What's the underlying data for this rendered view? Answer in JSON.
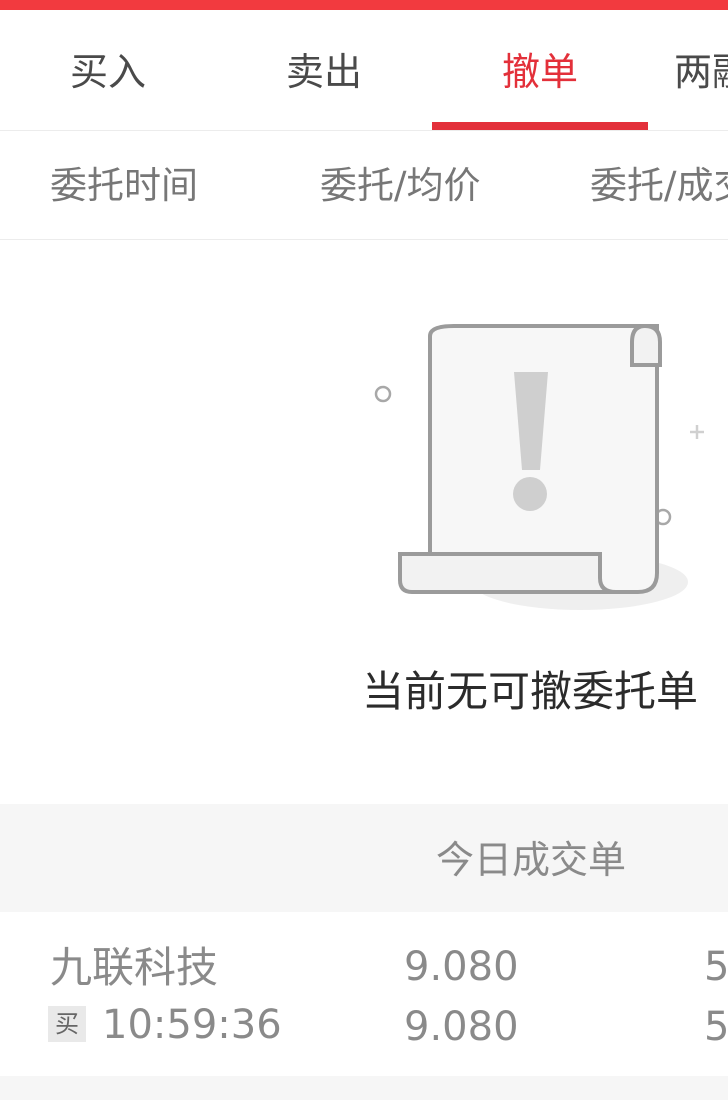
{
  "tabs": [
    {
      "label": "买入"
    },
    {
      "label": "卖出"
    },
    {
      "label": "撤单"
    },
    {
      "label": "两融"
    }
  ],
  "active_tab": "撤单",
  "columns": [
    "委托时间",
    "委托/均价",
    "委托/成交"
  ],
  "empty_state": {
    "icon": "document-alert-icon",
    "message": "当前无可撤委托单"
  },
  "today_trades": {
    "title": "今日成交单",
    "rows": [
      {
        "name": "九联科技",
        "side": "买",
        "time": "10:59:36",
        "price_1": "9.080",
        "price_2": "9.080",
        "qty_1": "5",
        "qty_2": "5"
      }
    ]
  },
  "colors": {
    "accent": "#e3303a",
    "top_strip": "#f23a3f"
  }
}
